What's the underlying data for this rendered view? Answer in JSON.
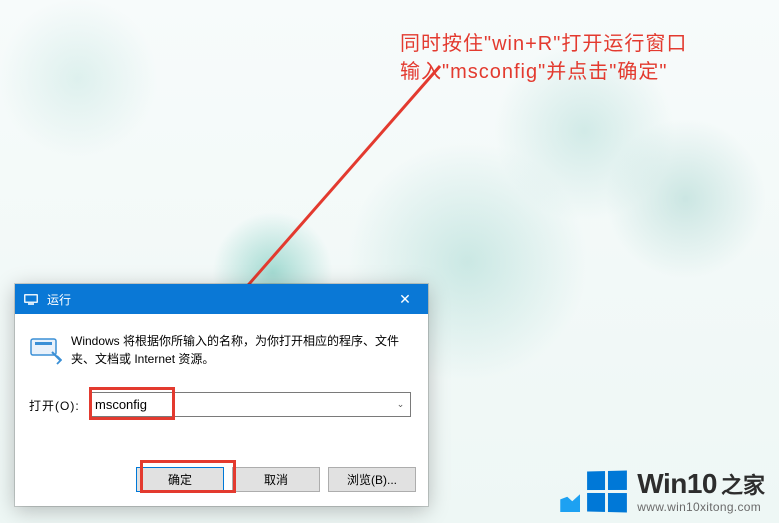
{
  "annotation": {
    "line1": "同时按住\"win+R\"打开运行窗口",
    "line2": "输入\"msconfig\"并点击\"确定\""
  },
  "dialog": {
    "title": "运行",
    "close_glyph": "✕",
    "description": "Windows 将根据你所输入的名称，为你打开相应的程序、文件夹、文档或 Internet 资源。",
    "open_label": "打开(O):",
    "input_value": "msconfig",
    "combo_arrow": "⌄",
    "ok_label": "确定",
    "cancel_label": "取消",
    "browse_label": "浏览(B)..."
  },
  "watermark": {
    "brand_en": "Win10",
    "brand_cn": "之家",
    "url": "www.win10xitong.com"
  }
}
